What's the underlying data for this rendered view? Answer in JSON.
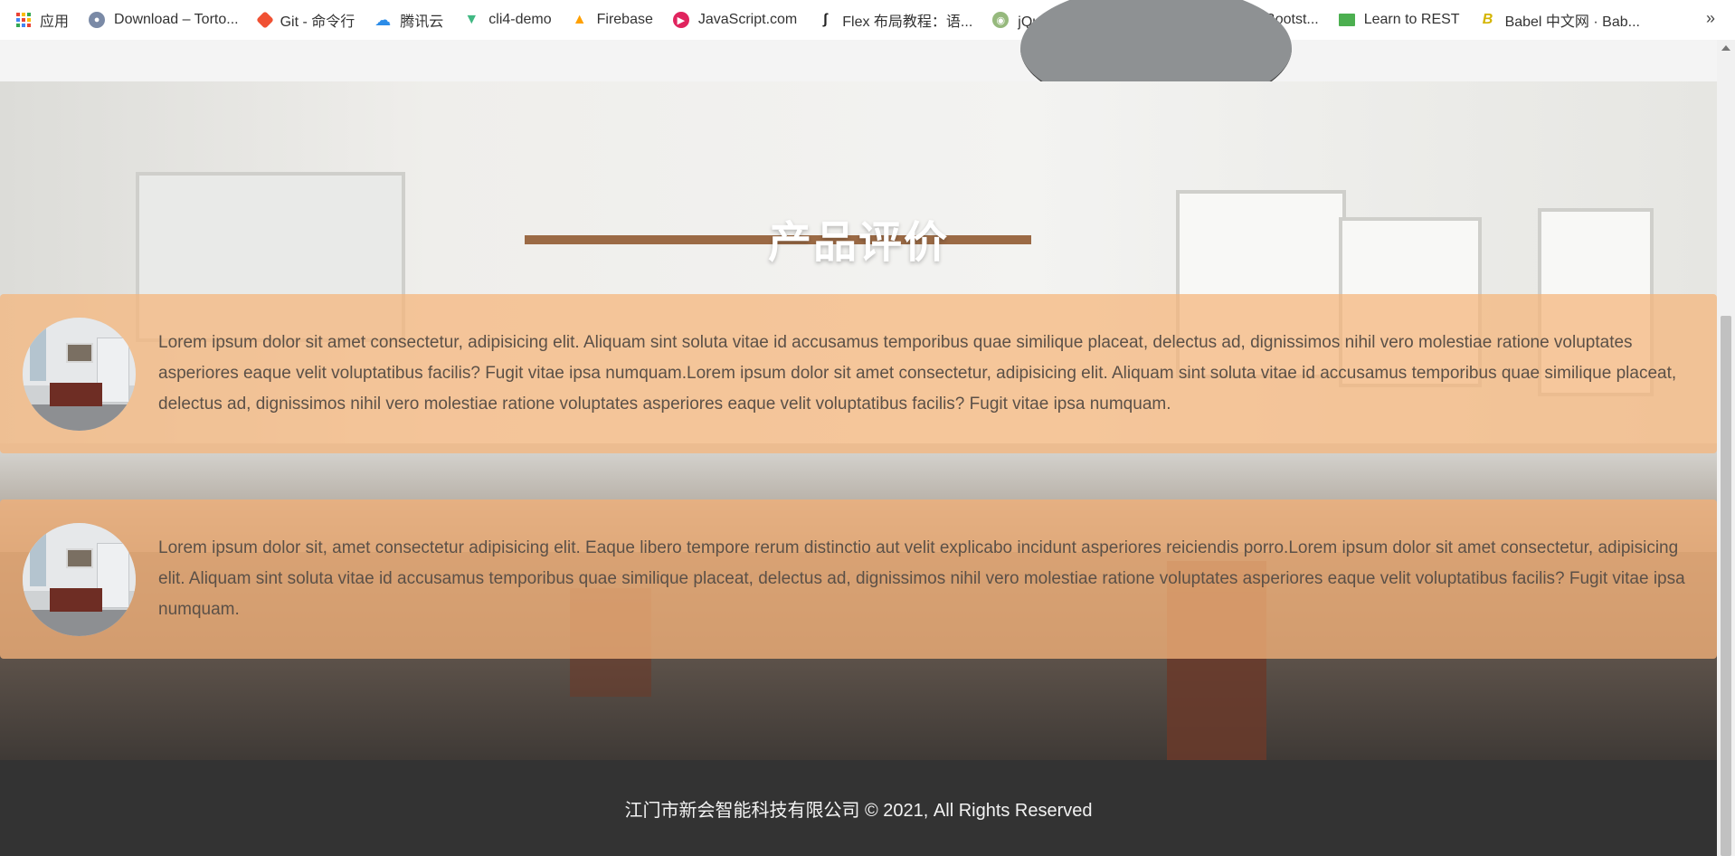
{
  "bookmarks": {
    "items": [
      {
        "label": "应用",
        "icon": "apps-grid-icon"
      },
      {
        "label": "Download – Torto...",
        "icon": "tortoise-icon"
      },
      {
        "label": "Git - 命令行",
        "icon": "git-icon",
        "color": "#f05133"
      },
      {
        "label": "腾讯云",
        "icon": "tencent-cloud-icon",
        "color": "#2b8ce8"
      },
      {
        "label": "cli4-demo",
        "icon": "vue-icon",
        "color": "#41b883"
      },
      {
        "label": "Firebase",
        "icon": "firebase-icon",
        "color": "#ffca28"
      },
      {
        "label": "JavaScript.com",
        "icon": "javascript-icon",
        "color": "#e0245e"
      },
      {
        "label": "Flex 布局教程：语...",
        "icon": "ruanyf-icon"
      },
      {
        "label": "jQuery 教程 | 菜鸟...",
        "icon": "runoob-icon",
        "color": "#96b97d"
      },
      {
        "label": "BootCDN - Bootst...",
        "icon": "bootcdn-icon",
        "color": "#0ea271"
      },
      {
        "label": "Learn to REST",
        "icon": "rest-icon",
        "color": "#4caf50"
      },
      {
        "label": "Babel 中文网 · Bab...",
        "icon": "babel-icon",
        "color": "#f5da55"
      }
    ],
    "more": "»"
  },
  "section": {
    "title": "产品评价"
  },
  "reviews": [
    {
      "text": "Lorem ipsum dolor sit amet consectetur, adipisicing elit. Aliquam sint soluta vitae id accusamus temporibus quae similique placeat, delectus ad, dignissimos nihil vero molestiae ratione voluptates asperiores eaque velit voluptatibus facilis? Fugit vitae ipsa numquam.Lorem ipsum dolor sit amet consectetur, adipisicing elit. Aliquam sint soluta vitae id accusamus temporibus quae similique placeat, delectus ad, dignissimos nihil vero molestiae ratione voluptates asperiores eaque velit voluptatibus facilis? Fugit vitae ipsa numquam."
    },
    {
      "text": "Lorem ipsum dolor sit, amet consectetur adipisicing elit. Eaque libero tempore rerum distinctio aut velit explicabo incidunt asperiores reiciendis porro.Lorem ipsum dolor sit amet consectetur, adipisicing elit. Aliquam sint soluta vitae id accusamus temporibus quae similique placeat, delectus ad, dignissimos nihil vero molestiae ratione voluptates asperiores eaque velit voluptatibus facilis? Fugit vitae ipsa numquam."
    }
  ],
  "footer": {
    "text": "江门市新会智能科技有限公司 © 2021, All Rights Reserved"
  },
  "colors": {
    "card": "#f5b478",
    "footer": "#333333",
    "title": "#ffffff"
  }
}
